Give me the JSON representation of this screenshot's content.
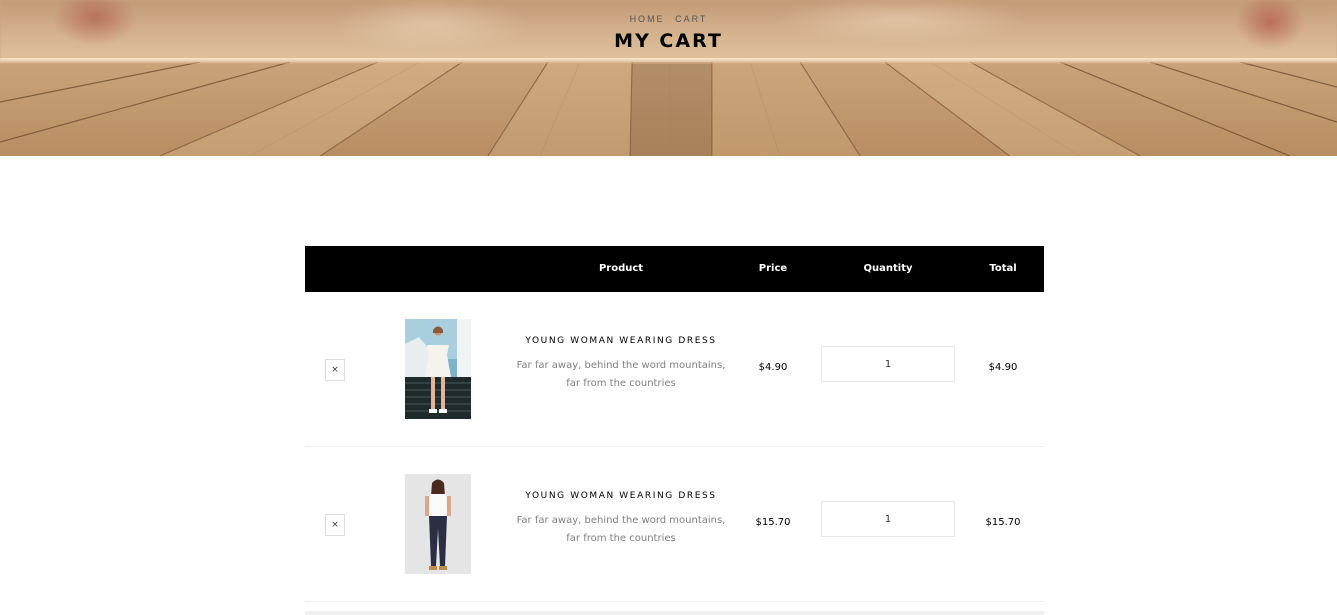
{
  "hero": {
    "breadcrumb": {
      "home": "Home",
      "current": "Cart"
    },
    "title": "My Cart"
  },
  "table": {
    "headers": {
      "product": "Product",
      "price": "Price",
      "quantity": "Quantity",
      "total": "Total"
    },
    "rows": [
      {
        "remove_label": "×",
        "name": "Young Woman Wearing Dress",
        "description": "Far far away, behind the word mountains, far from the countries",
        "price": "$4.90",
        "quantity": "1",
        "total": "$4.90"
      },
      {
        "remove_label": "×",
        "name": "Young Woman Wearing Dress",
        "description": "Far far away, behind the word mountains, far from the countries",
        "price": "$15.70",
        "quantity": "1",
        "total": "$15.70"
      }
    ]
  },
  "colors": {
    "header_bg": "#000000",
    "header_text": "#ffffff",
    "desc_text": "#808080",
    "row_border": "#eeeeee"
  }
}
